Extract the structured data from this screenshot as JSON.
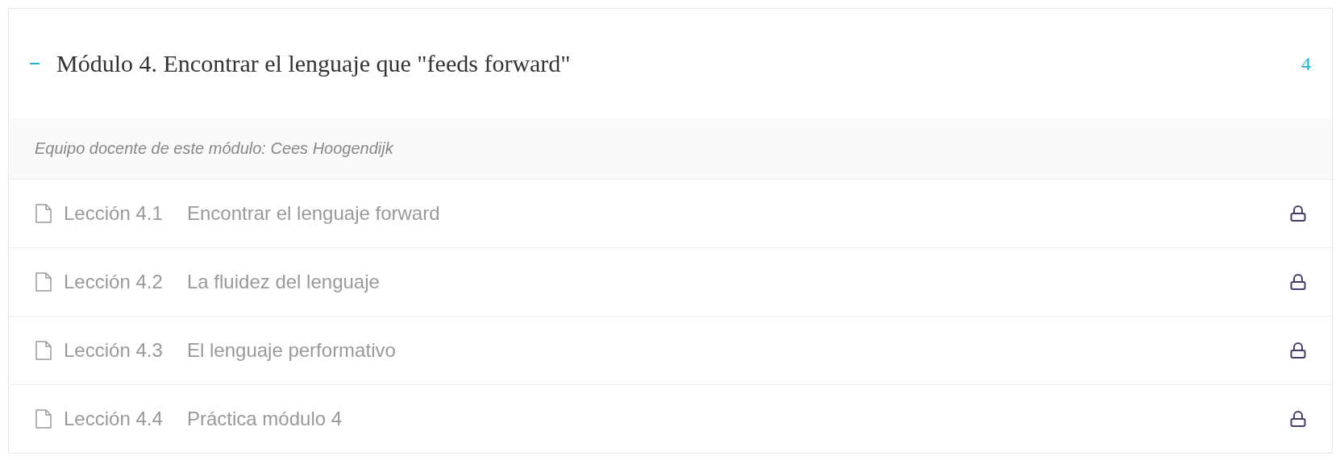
{
  "module": {
    "title": "Módulo 4. Encontrar el lenguaje que \"feeds forward\"",
    "expanded": true,
    "count": "4",
    "instructors": "Equipo docente de este módulo: Cees Hoogendijk",
    "lessons": [
      {
        "number": "Lección 4.1",
        "title": "Encontrar el lenguaje forward",
        "locked": true
      },
      {
        "number": "Lección 4.2",
        "title": "La fluidez del lenguaje",
        "locked": true
      },
      {
        "number": "Lección 4.3",
        "title": "El lenguaje performativo",
        "locked": true
      },
      {
        "number": "Lección 4.4",
        "title": "Práctica módulo 4",
        "locked": true
      }
    ]
  }
}
